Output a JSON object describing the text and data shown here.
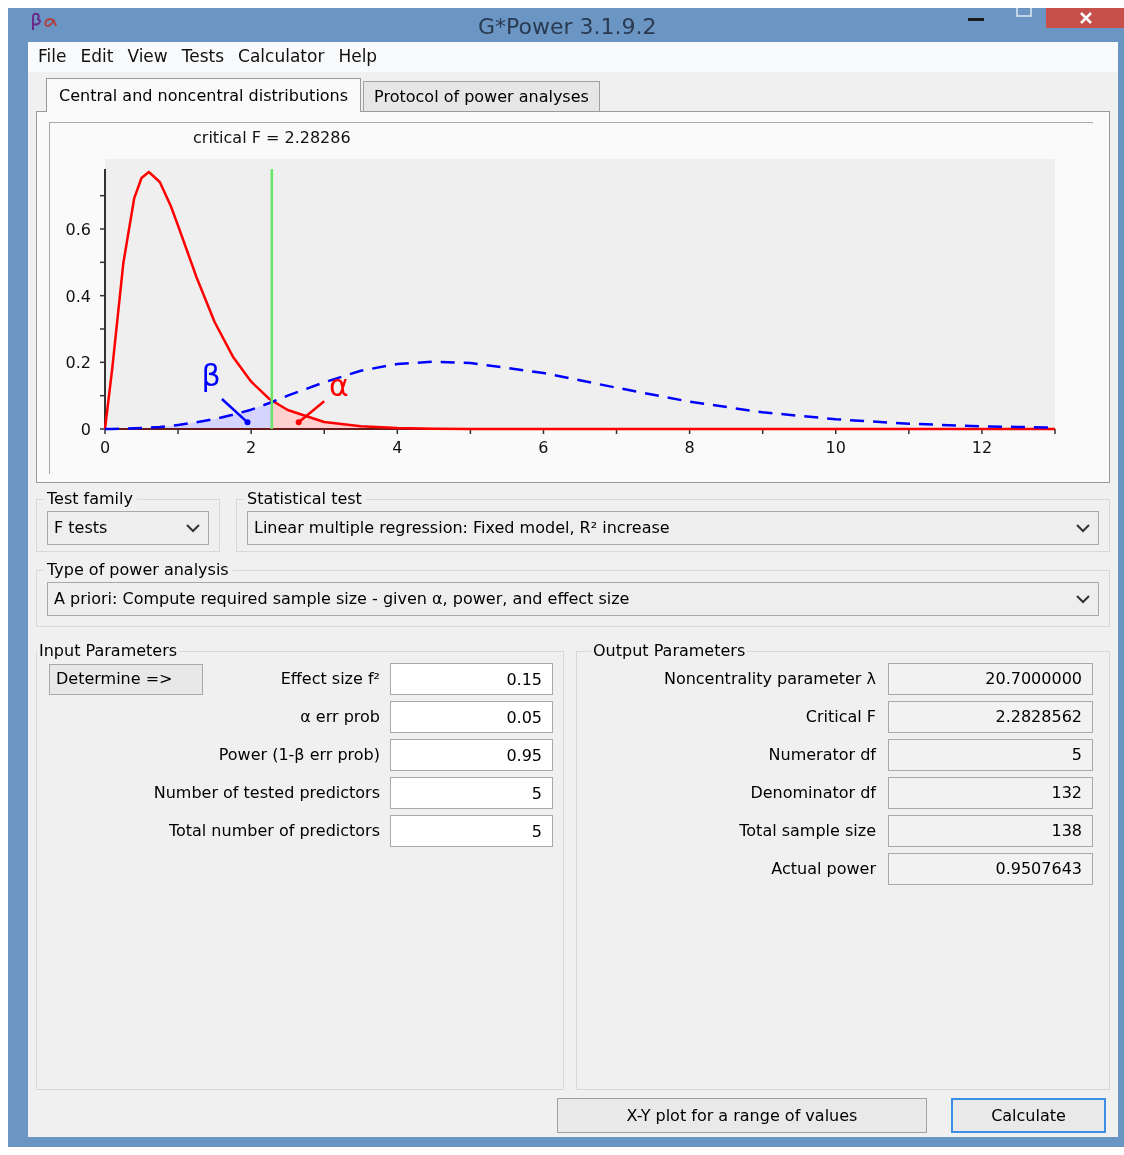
{
  "window": {
    "title": "G*Power 3.1.9.2"
  },
  "menu": [
    "File",
    "Edit",
    "View",
    "Tests",
    "Calculator",
    "Help"
  ],
  "tabs": [
    {
      "label": "Central and noncentral distributions",
      "selected": true
    },
    {
      "label": "Protocol of power analyses",
      "selected": false
    }
  ],
  "chart": {
    "chart_data": {
      "type": "line",
      "xlim": [
        0,
        13
      ],
      "ylim": [
        0,
        0.78
      ],
      "xticks": [
        0,
        2,
        4,
        6,
        8,
        10,
        12
      ],
      "yticks": [
        0,
        0.2,
        0.4,
        0.6
      ],
      "x": [
        0,
        0.1,
        0.25,
        0.4,
        0.5,
        0.6,
        0.75,
        0.9,
        1,
        1.25,
        1.5,
        1.75,
        2,
        2.25,
        2.5,
        3,
        3.5,
        4,
        4.5,
        5,
        6,
        7,
        8,
        9,
        10,
        11,
        12,
        13
      ],
      "series": [
        {
          "color": "#ff0000",
          "values": [
            0,
            0.183,
            0.497,
            0.692,
            0.753,
            0.771,
            0.741,
            0.669,
            0.61,
            0.457,
            0.321,
            0.217,
            0.142,
            0.09,
            0.057,
            0.021,
            0.008,
            0.003,
            0.001,
            0,
            0,
            0,
            0,
            0,
            0,
            0,
            0,
            0
          ]
        },
        {
          "color": "#0000ff",
          "line_style": "dashed",
          "values": [
            0,
            0,
            0.001,
            0.002,
            0.003,
            0.004,
            0.006,
            0.009,
            0.012,
            0.02,
            0.03,
            0.043,
            0.058,
            0.078,
            0.1,
            0.14,
            0.175,
            0.195,
            0.202,
            0.198,
            0.168,
            0.124,
            0.082,
            0.05,
            0.029,
            0.016,
            0.008,
            0.004
          ]
        }
      ],
      "ref_lines": [
        {
          "axis": "x",
          "value": 2.28286,
          "label": "critical F = 2.28286",
          "color": "#66e566"
        }
      ],
      "annotations": [
        {
          "text": "β"
        },
        {
          "text": "α"
        }
      ]
    }
  },
  "test_family": {
    "label": "Test family",
    "value": "F tests"
  },
  "statistical_test": {
    "label": "Statistical test",
    "value": "Linear multiple regression: Fixed model, R² increase"
  },
  "power_analysis_type": {
    "label": "Type of power analysis",
    "value": "A priori: Compute required sample size - given α, power, and effect size"
  },
  "input_parameters": {
    "title": "Input Parameters",
    "determine_button": "Determine =>",
    "fields": [
      {
        "label": "Effect size f²",
        "value": "0.15"
      },
      {
        "label": "α err prob",
        "value": "0.05"
      },
      {
        "label": "Power (1-β err prob)",
        "value": "0.95"
      },
      {
        "label": "Number of tested predictors",
        "value": "5"
      },
      {
        "label": "Total number of predictors",
        "value": "5"
      }
    ]
  },
  "output_parameters": {
    "title": "Output Parameters",
    "fields": [
      {
        "label": "Noncentrality parameter λ",
        "value": "20.7000000"
      },
      {
        "label": "Critical F",
        "value": "2.2828562"
      },
      {
        "label": "Numerator df",
        "value": "5"
      },
      {
        "label": "Denominator df",
        "value": "132"
      },
      {
        "label": "Total sample size",
        "value": "138"
      },
      {
        "label": "Actual power",
        "value": "0.9507643"
      }
    ]
  },
  "buttons": [
    {
      "label": "X-Y plot for a range of values",
      "focused": false
    },
    {
      "label": "Calculate",
      "focused": true
    }
  ]
}
